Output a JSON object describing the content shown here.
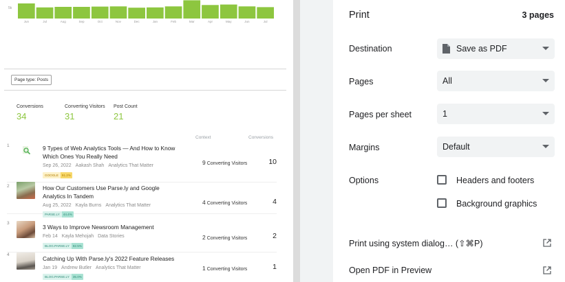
{
  "preview": {
    "y_tick": "5k",
    "chart_data": {
      "type": "bar",
      "categories": [
        "Jun",
        "Jul",
        "Aug",
        "Sep",
        "Oct",
        "Nov",
        "Dec",
        "Jan",
        "Feb",
        "Mar",
        "Apr",
        "May",
        "Jun",
        "Jul"
      ],
      "values": [
        5.7,
        4.2,
        4.4,
        4.4,
        4.5,
        4.6,
        4.1,
        4.2,
        4.6,
        6.9,
        5.1,
        5.3,
        4.6,
        4.3
      ],
      "ylim": [
        0,
        7
      ],
      "color": "#8dc63f"
    },
    "page_type_label": "Page type: Posts",
    "stats": [
      {
        "label": "Conversions",
        "value": "34"
      },
      {
        "label": "Converting Visitors",
        "value": "31"
      },
      {
        "label": "Post Count",
        "value": "21"
      }
    ],
    "columns": {
      "context": "Context",
      "conversions": "Conversions"
    },
    "posts": [
      {
        "rank": "1",
        "title": "9 Types of Web Analytics Tools — And How to Know Which Ones You Really Need",
        "date": "Sep 26, 2022",
        "author": "Aakash Shah",
        "section": "Analytics That Matter",
        "ref": "GOOGLE",
        "ref_pct": "91.2%",
        "tag_bg": "#fdf1c7",
        "tag_pct_bg": "#f7d86b",
        "tag_color": "#b07b00",
        "converting_visitors_count": "9",
        "converting_visitors_label": "Converting Visitors",
        "conversions": "10",
        "thumb": "search-thumbnail"
      },
      {
        "rank": "2",
        "title": "How Our Customers Use Parse.ly and Google Analytics In Tandem",
        "date": "Aug 25, 2022",
        "author": "Kayla Burns",
        "section": "Analytics That Matter",
        "ref": "PARSE.LY",
        "ref_pct": "44.4%",
        "tag_bg": "#d9f2ec",
        "tag_pct_bg": "#a9e2d3",
        "tag_color": "#2e8b77",
        "converting_visitors_count": "4",
        "converting_visitors_label": "Converting Visitors",
        "conversions": "4",
        "thumb": "photo-thumbnail"
      },
      {
        "rank": "3",
        "title": "3 Ways to Improve Newsroom Management",
        "date": "Feb 14",
        "author": "Kayla Mehojah",
        "section": "Data Stories",
        "ref": "BLOG.PARSE.LY",
        "ref_pct": "82.5%",
        "tag_bg": "#d9f2ec",
        "tag_pct_bg": "#a9e2d3",
        "tag_color": "#2e8b77",
        "converting_visitors_count": "2",
        "converting_visitors_label": "Converting Visitors",
        "conversions": "2",
        "thumb": "photo-thumbnail"
      },
      {
        "rank": "4",
        "title": "Catching Up With Parse.ly's 2022 Feature Releases",
        "date": "Jan 19",
        "author": "Andrew Butler",
        "section": "Analytics That Matter",
        "ref": "BLOG.PARSE.LY",
        "ref_pct": "35.0%",
        "tag_bg": "#d9f2ec",
        "tag_pct_bg": "#a9e2d3",
        "tag_color": "#2e8b77",
        "converting_visitors_count": "1",
        "converting_visitors_label": "Converting Visitors",
        "conversions": "1",
        "thumb": "photo-thumbnail"
      }
    ]
  },
  "print": {
    "title": "Print",
    "page_count": "3 pages",
    "destination_label": "Destination",
    "destination_value": "Save as PDF",
    "pages_label": "Pages",
    "pages_value": "All",
    "pages_per_sheet_label": "Pages per sheet",
    "pages_per_sheet_value": "1",
    "margins_label": "Margins",
    "margins_value": "Default",
    "options_label": "Options",
    "headers_footers_label": "Headers and footers",
    "background_graphics_label": "Background graphics",
    "system_dialog_label": "Print using system dialog… (⇧⌘P)",
    "open_pdf_label": "Open PDF in Preview"
  }
}
